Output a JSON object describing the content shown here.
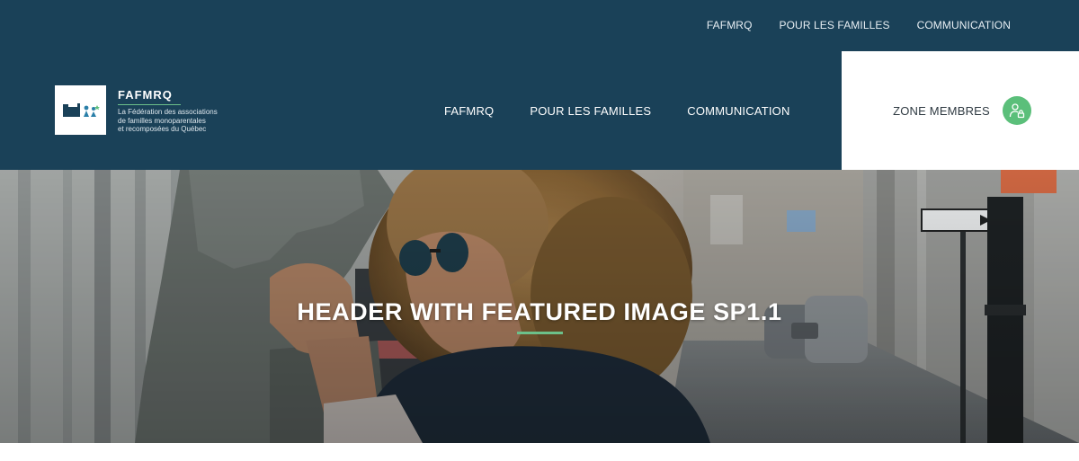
{
  "utility_nav": [
    "FAFMRQ",
    "POUR LES FAMILLES",
    "COMMUNICATION"
  ],
  "logo": {
    "title": "FAFMRQ",
    "subtitle_lines": [
      "La Fédération des associations",
      "de familles monoparentales",
      "et recomposées du Québec"
    ]
  },
  "main_nav": [
    "FAFMRQ",
    "POUR LES FAMILLES",
    "COMMUNICATION"
  ],
  "members": {
    "label": "ZONE MEMBRES",
    "icon": "user-lock-icon"
  },
  "hero": {
    "title": "HEADER WITH FEATURED IMAGE SP1.1"
  },
  "colors": {
    "header_bg": "#1a4158",
    "accent_green": "#5bbf7a",
    "white": "#ffffff"
  }
}
